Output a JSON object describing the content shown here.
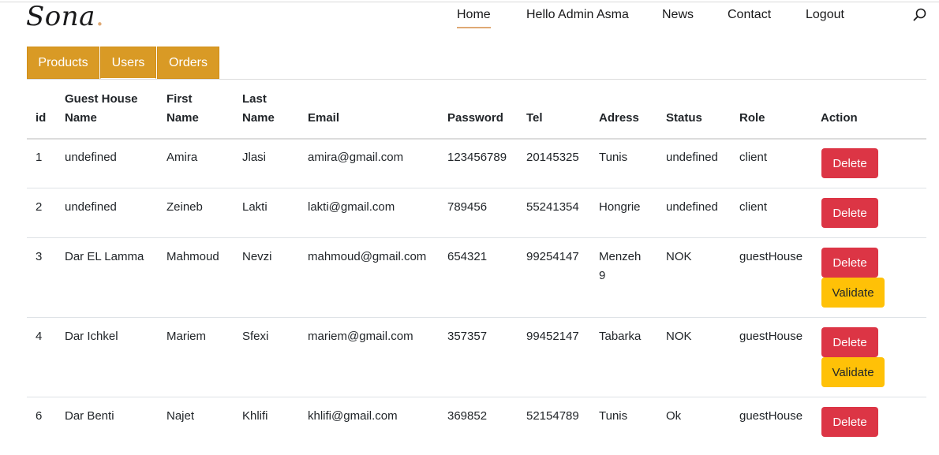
{
  "brand": {
    "name": "Sona",
    "dot": ".",
    "accent": "#dfa974"
  },
  "nav": {
    "items": [
      {
        "label": "Home",
        "active": true
      },
      {
        "label": "Hello Admin Asma"
      },
      {
        "label": "News"
      },
      {
        "label": "Contact"
      },
      {
        "label": "Logout"
      }
    ],
    "search_icon": "search-icon"
  },
  "tabs": [
    {
      "label": "Products"
    },
    {
      "label": "Users",
      "active": true
    },
    {
      "label": "Orders"
    }
  ],
  "table": {
    "headers": {
      "id": "id",
      "gh1": "Guest House",
      "gh2": "Name",
      "fn1": "First",
      "fn2": "Name",
      "ln1": "Last",
      "ln2": "Name",
      "email": "Email",
      "password": "Password",
      "tel": "Tel",
      "adress": "Adress",
      "status": "Status",
      "role": "Role",
      "action": "Action"
    },
    "rows": [
      {
        "id": "1",
        "guesthouse": "undefined",
        "first": "Amira",
        "last": "Jlasi",
        "email": "amira@gmail.com",
        "password": "123456789",
        "tel": "20145325",
        "adress1": "Tunis",
        "adress2": "",
        "status": "undefined",
        "role": "client",
        "delete": "Delete",
        "validate": ""
      },
      {
        "id": "2",
        "guesthouse": "undefined",
        "first": "Zeineb",
        "last": "Lakti",
        "email": "lakti@gmail.com",
        "password": "789456",
        "tel": "55241354",
        "adress1": "Hongrie",
        "adress2": "",
        "status": "undefined",
        "role": "client",
        "delete": "Delete",
        "validate": ""
      },
      {
        "id": "3",
        "guesthouse": "Dar EL Lamma",
        "first": "Mahmoud",
        "last": "Nevzi",
        "email": "mahmoud@gmail.com",
        "password": "654321",
        "tel": "99254147",
        "adress1": "Menzeh",
        "adress2": "9",
        "status": "NOK",
        "role": "guestHouse",
        "delete": "Delete",
        "validate": "Validate"
      },
      {
        "id": "4",
        "guesthouse": "Dar Ichkel",
        "first": "Mariem",
        "last": "Sfexi",
        "email": "mariem@gmail.com",
        "password": "357357",
        "tel": "99452147",
        "adress1": "Tabarka",
        "adress2": "",
        "status": "NOK",
        "role": "guestHouse",
        "delete": "Delete",
        "validate": "Validate"
      },
      {
        "id": "6",
        "guesthouse": "Dar Benti",
        "first": "Najet",
        "last": "Khlifi",
        "email": "khlifi@gmail.com",
        "password": "369852",
        "tel": "52154789",
        "adress1": "Tunis",
        "adress2": "",
        "status": "Ok",
        "role": "guestHouse",
        "delete": "Delete",
        "validate": ""
      }
    ]
  },
  "colors": {
    "tab": "#d99a25",
    "delete": "#dc3545",
    "validate": "#ffc107"
  }
}
